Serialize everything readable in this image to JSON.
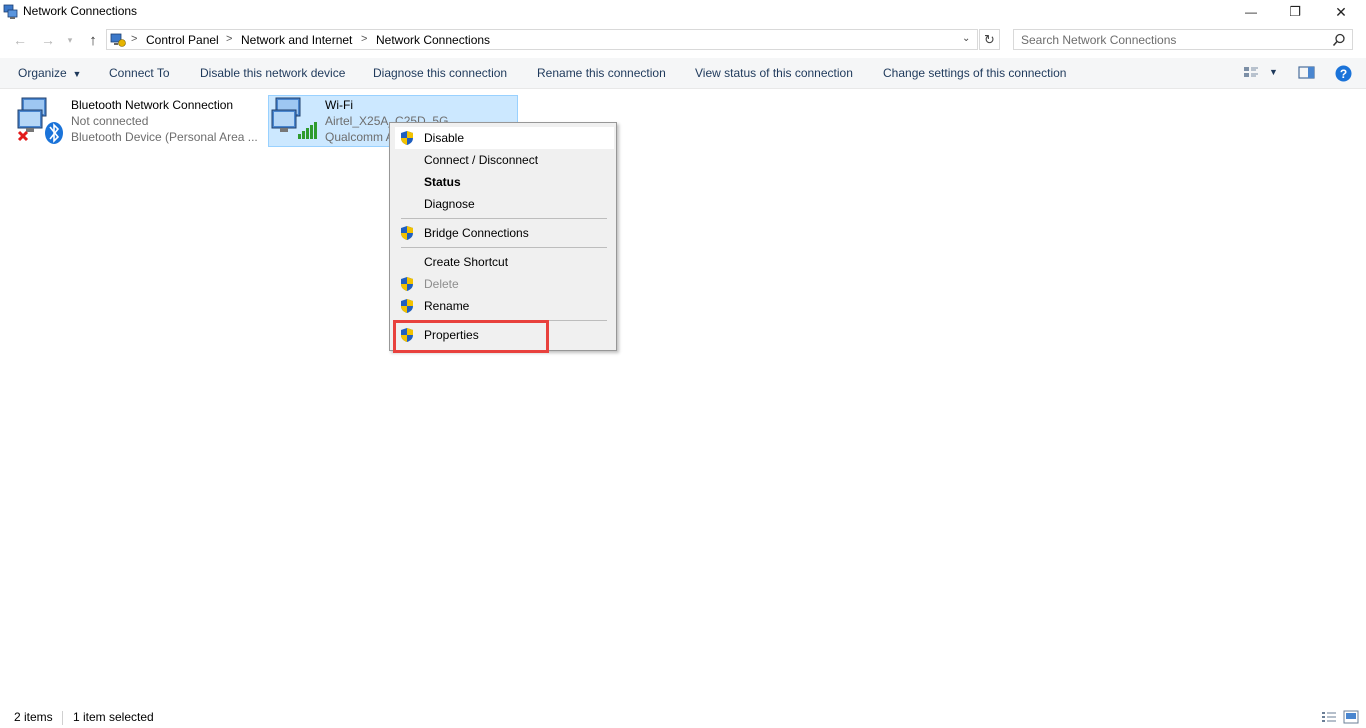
{
  "window": {
    "title": "Network Connections",
    "controls": {
      "minimize": "—",
      "maximize": "❐",
      "close": "✕"
    }
  },
  "address_bar": {
    "breadcrumbs": [
      "Control Panel",
      "Network and Internet",
      "Network Connections"
    ],
    "separator": ">",
    "search_placeholder": "Search Network Connections"
  },
  "toolbar": {
    "organize": "Organize",
    "items": [
      "Connect To",
      "Disable this network device",
      "Diagnose this connection",
      "Rename this connection",
      "View status of this connection",
      "Change settings of this connection"
    ]
  },
  "connections": [
    {
      "name": "Bluetooth Network Connection",
      "status": "Not connected",
      "device": "Bluetooth Device (Personal Area ..."
    },
    {
      "name": "Wi-Fi",
      "status": "Airtel_X25A_C25D_5G",
      "device": "Qualcomm A"
    }
  ],
  "context_menu": {
    "items": [
      {
        "label": "Disable",
        "shield": true,
        "state": "hover"
      },
      {
        "label": "Connect / Disconnect",
        "shield": false
      },
      {
        "label": "Status",
        "shield": false,
        "bold": true
      },
      {
        "label": "Diagnose",
        "shield": false
      },
      {
        "label": "Bridge Connections",
        "shield": true
      },
      {
        "label": "Create Shortcut",
        "shield": false
      },
      {
        "label": "Delete",
        "shield": true,
        "disabled": true
      },
      {
        "label": "Rename",
        "shield": true
      },
      {
        "label": "Properties",
        "shield": true,
        "highlighted": true
      }
    ]
  },
  "status_bar": {
    "item_count": "2 items",
    "selection": "1 item selected"
  },
  "colors": {
    "selection_bg": "#cce8ff",
    "toolbar_text": "#1e395b",
    "highlight_box": "#e8413d",
    "help_blue": "#1a73d9"
  }
}
